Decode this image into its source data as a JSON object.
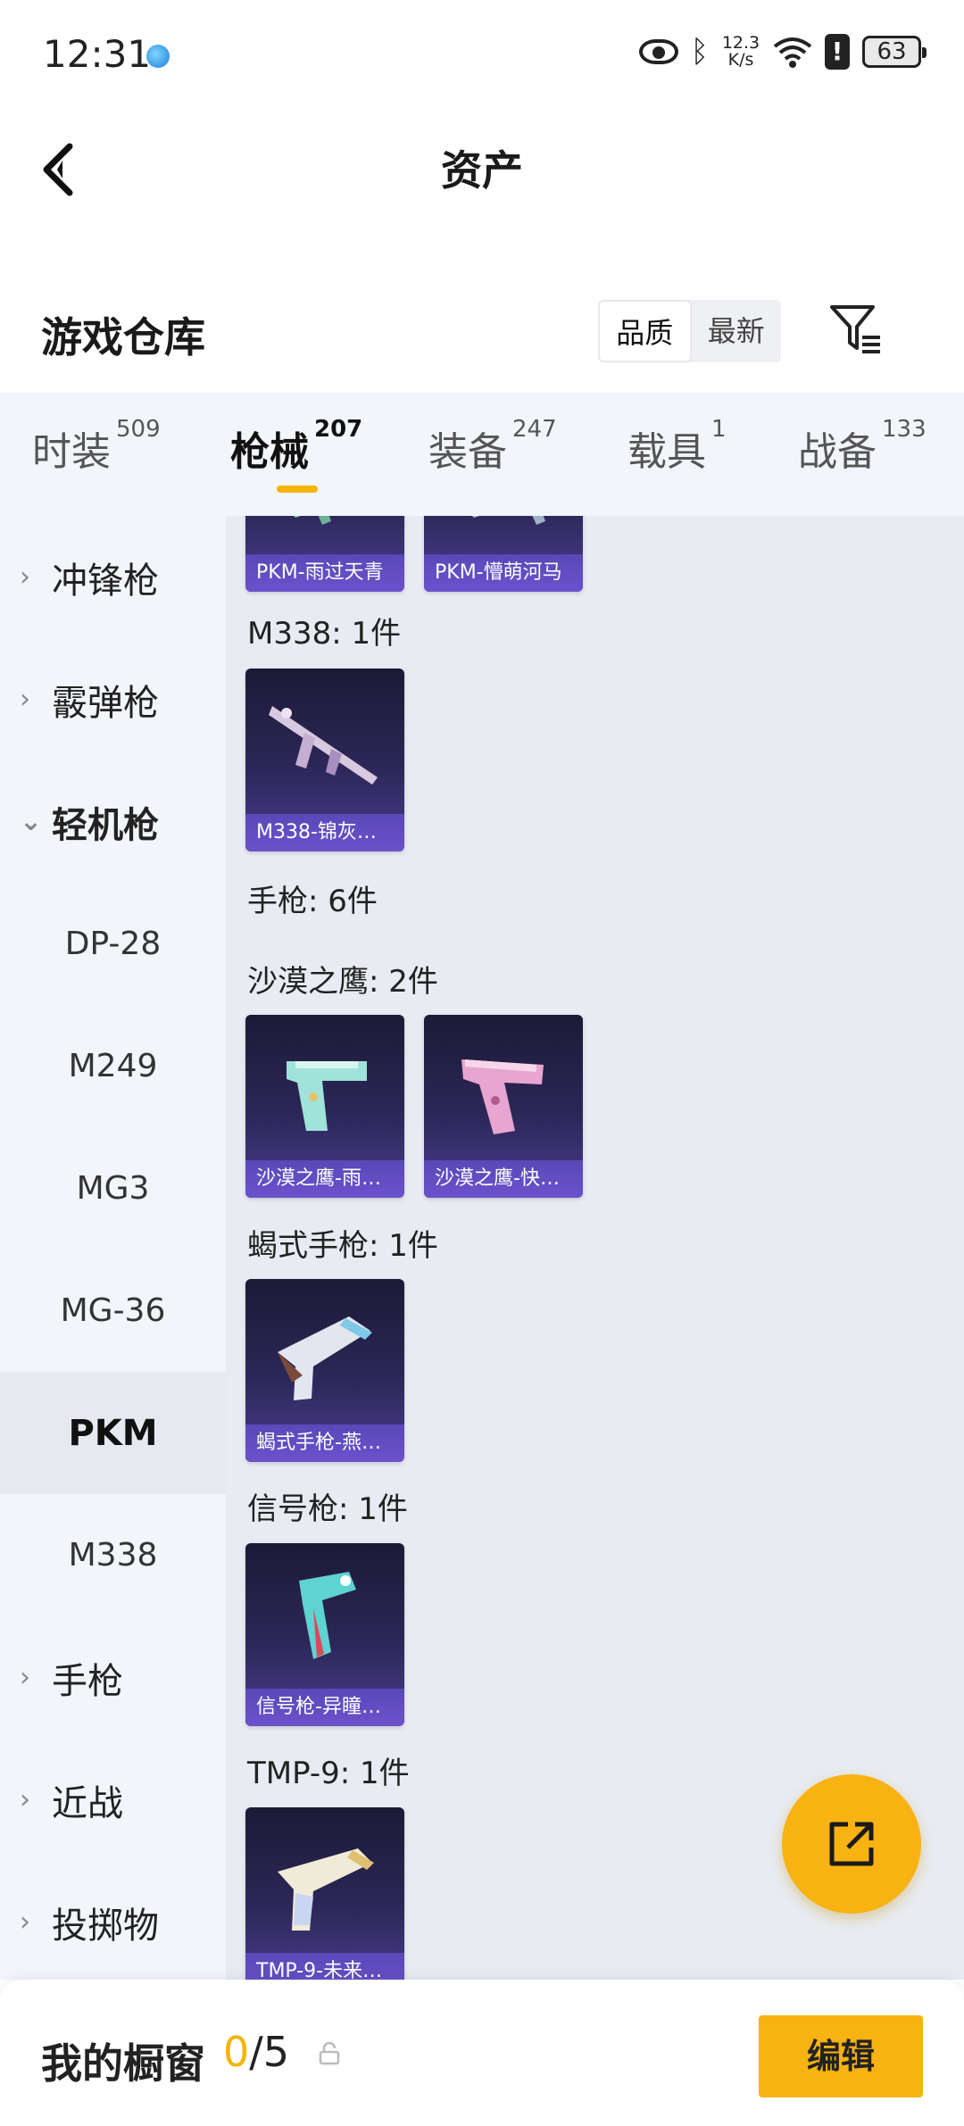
{
  "status_bar": {
    "time": "12:31",
    "net_speed": "12.3\nK/s",
    "battery": "63"
  },
  "header": {
    "title": "资产"
  },
  "warehouse": {
    "title": "游戏仓库",
    "sort_options": [
      "品质",
      "最新"
    ],
    "sort_selected": "品质"
  },
  "tabs": [
    {
      "label": "时装",
      "count": "509"
    },
    {
      "label": "枪械",
      "count": "207",
      "active": true
    },
    {
      "label": "装备",
      "count": "247"
    },
    {
      "label": "载具",
      "count": "1"
    },
    {
      "label": "战备",
      "count": "133"
    }
  ],
  "sidebar": {
    "items": [
      {
        "label": "冲锋枪",
        "chevron": "›"
      },
      {
        "label": "霰弹枪",
        "chevron": "›"
      },
      {
        "label": "轻机枪",
        "chevron": "⌄"
      },
      {
        "label": "DP-28"
      },
      {
        "label": "M249"
      },
      {
        "label": "MG3"
      },
      {
        "label": "MG-36"
      },
      {
        "label": "PKM",
        "selected": true
      },
      {
        "label": "M338"
      },
      {
        "label": "手枪",
        "chevron": "›"
      },
      {
        "label": "近战",
        "chevron": "›"
      },
      {
        "label": "投掷物",
        "chevron": "›"
      }
    ]
  },
  "content": {
    "groups": [
      {
        "label": "",
        "items": [
          "PKM-雨过天青",
          "PKM-懵萌河马"
        ]
      },
      {
        "label": "M338: 1件",
        "items": [
          "M338-锦灰…"
        ]
      },
      {
        "label": "手枪: 6件",
        "items": []
      },
      {
        "label": "沙漠之鹰: 2件",
        "items": [
          "沙漠之鹰-雨…",
          "沙漠之鹰-快…"
        ]
      },
      {
        "label": "蝎式手枪: 1件",
        "items": [
          "蝎式手枪-燕…"
        ]
      },
      {
        "label": "信号枪: 1件",
        "items": [
          "信号枪-异瞳…"
        ]
      },
      {
        "label": "TMP-9: 1件",
        "items": [
          "TMP-9-未来…"
        ]
      }
    ]
  },
  "bottom_bar": {
    "title": "我的橱窗",
    "count_current": "0",
    "count_total": "/5",
    "edit_label": "编辑"
  },
  "colors": {
    "accent": "#f8b211",
    "card_bg": "#2c2758",
    "card_caption": "#6a52cc"
  }
}
